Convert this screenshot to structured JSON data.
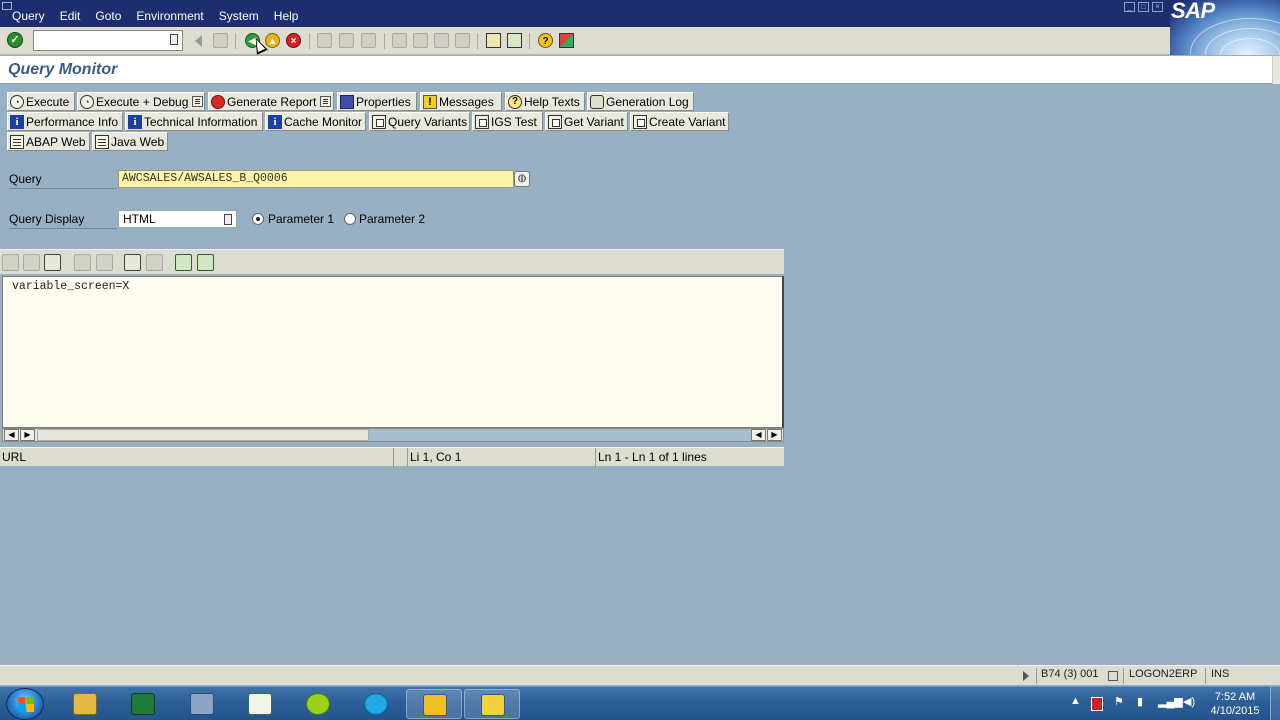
{
  "menubar": {
    "items": [
      "Query",
      "Edit",
      "Goto",
      "Environment",
      "System",
      "Help"
    ],
    "logo": "SAP"
  },
  "toolbar": {
    "command_field_value": "",
    "icons": [
      "enter-icon",
      "back-icon",
      "save-icon",
      "green-back-icon",
      "exit-icon",
      "cancel-icon",
      "print-icon",
      "find-icon",
      "find-next-icon",
      "first-page-icon",
      "previous-page-icon",
      "next-page-icon",
      "last-page-icon",
      "create-session-icon",
      "shortcut-icon",
      "help-icon",
      "customize-layout-icon"
    ]
  },
  "title": "Query Monitor",
  "app_toolbar": {
    "row1": [
      "Execute",
      "Execute + Debug",
      "Generate Report",
      "Properties",
      "Messages",
      "Help Texts",
      "Generation Log"
    ],
    "row2": [
      "Performance Info",
      "Technical Information",
      "Cache Monitor",
      "Query Variants",
      "IGS Test",
      "Get Variant",
      "Create Variant"
    ],
    "row3": [
      "ABAP Web",
      "Java Web"
    ]
  },
  "form": {
    "query_label": "Query",
    "query_value": "AWCSALES/AWSALES_B_Q0006",
    "display_label": "Query Display",
    "display_value": "HTML",
    "radio1_label": "Parameter 1",
    "radio2_label": "Parameter 2",
    "radio_selected": "Parameter 1"
  },
  "editor": {
    "lines": [
      "variable_screen=X"
    ],
    "scroll_position": 0
  },
  "statusline": {
    "field": "URL",
    "cursor": "Li 1, Co 1",
    "lines": "Ln 1 - Ln 1 of 1 lines"
  },
  "sap_status": {
    "system": "B74 (3) 001",
    "server": "LOGON2ERP",
    "mode": "INS"
  },
  "taskbar": {
    "apps": [
      "file-explorer-icon",
      "excel-icon",
      "outlook-icon",
      "project-icon",
      "add-app-icon",
      "skype-icon",
      "sap-logon-icon",
      "sap-gui-icon"
    ],
    "time": "7:52 AM",
    "date": "4/10/2015"
  },
  "colors": {
    "menubar": "#1c2d70",
    "background": "#97b0c4",
    "title": "#3a5b84",
    "required_field": "#fff4a8",
    "editor": "#fffdf0"
  }
}
